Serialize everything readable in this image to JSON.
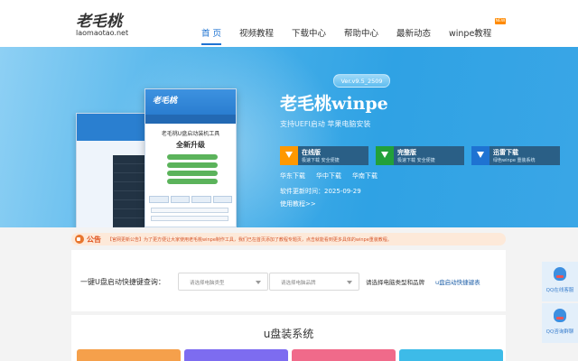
{
  "logo": {
    "cn": "老毛桃",
    "en": "laomaotao.net"
  },
  "nav": {
    "items": [
      {
        "label": "首 页",
        "active": true
      },
      {
        "label": "视频教程"
      },
      {
        "label": "下载中心"
      },
      {
        "label": "帮助中心"
      },
      {
        "label": "最新动态"
      },
      {
        "label": "winpe教程"
      }
    ],
    "hot_badge": "NEW"
  },
  "banner": {
    "version": "Ver.v9.5_2509",
    "title": "老毛桃winpe",
    "subtitle": "支持UEFI启动 苹果电脑安装",
    "screenshot": {
      "tool_title": "老毛桃U盘启动装机工具",
      "upgrade_text": "全新升级"
    },
    "download_buttons": [
      {
        "title": "在线版",
        "desc": "极速下载 安全便捷",
        "icon": "download-icon",
        "color": "#ff9800"
      },
      {
        "title": "完整版",
        "desc": "极速下载 安全便捷",
        "icon": "download-icon",
        "color": "#22a03a"
      },
      {
        "title": "迅雷下载",
        "desc": "绿色winpe 重装系统",
        "icon": "thunder-icon",
        "color": "#1e73d2"
      }
    ],
    "mirrors": [
      "华东下载",
      "华中下载",
      "华南下载"
    ],
    "update_time": "软件更新时间：2025-09-29",
    "tutorial_link": "使用教程>>"
  },
  "notice": {
    "label": "公告",
    "text": "【官网更新公告】为了更方便让大家使用老毛桃winpe制作工具，我们已在首页添加了教程专题页，点击就能看到更多具体的winpe重装教程。"
  },
  "query": {
    "label": "一键U盘启动快捷键查询：",
    "select1_placeholder": "请选择电脑类型",
    "select2_placeholder": "请选择电脑品牌",
    "hint": "请选择电脑类型和品牌",
    "link": "u盘启动快捷键表"
  },
  "section": {
    "title": "u盘装系统"
  },
  "cards": [
    {
      "color": "#f5a04b"
    },
    {
      "color": "#7d6cf0"
    },
    {
      "color": "#f06a8a"
    },
    {
      "color": "#3dbbe8"
    }
  ],
  "side_buttons": [
    {
      "label": "QQ在线客服",
      "icon": "qq-icon"
    },
    {
      "label": "QQ咨询群聊",
      "icon": "qq-icon"
    }
  ]
}
